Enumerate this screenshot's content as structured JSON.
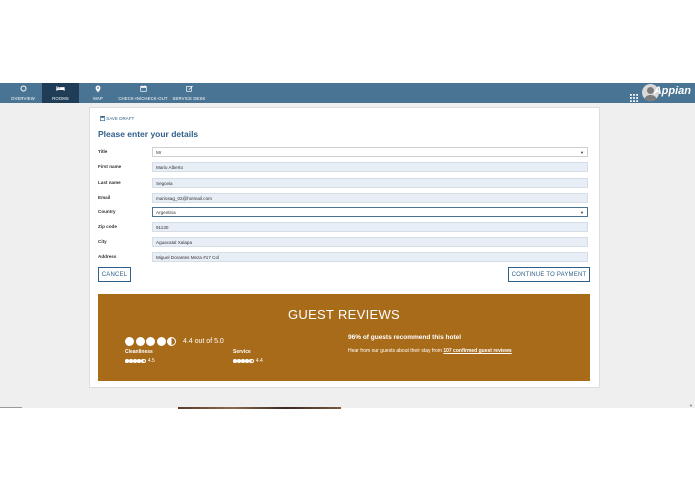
{
  "brand": "Appian",
  "nav": {
    "items": [
      {
        "label": "OVERVIEW",
        "icon": "circle-icon"
      },
      {
        "label": "ROOMS",
        "icon": "bed-icon"
      },
      {
        "label": "MAP",
        "icon": "map-pin-icon"
      },
      {
        "label": "CHECK-IN/CHECK-OUT",
        "icon": "calendar-icon"
      },
      {
        "label": "SERVICE DESK",
        "icon": "edit-icon"
      }
    ],
    "active": "ROOMS"
  },
  "form": {
    "save_draft": "SAVE DRAFT",
    "title": "Please enter your details",
    "fields": [
      {
        "label": "Title",
        "value": "Mr"
      },
      {
        "label": "First name",
        "value": "Mario Alberto"
      },
      {
        "label": "Last name",
        "value": "Segovia"
      },
      {
        "label": "Email",
        "value": "mariosag_02@hotmail.com"
      },
      {
        "label": "Country",
        "value": "Argentina"
      },
      {
        "label": "Zip code",
        "value": "91130"
      },
      {
        "label": "City",
        "value": "Aguacatal Xalapa"
      },
      {
        "label": "Address",
        "value": "Miguel Dorantes Meza #17 Col"
      }
    ],
    "cancel_label": "CANCEL",
    "continue_label": "CONTINUE TO PAYMENT"
  },
  "reviews": {
    "title": "GUEST REVIEWS",
    "rating_text": "4.4 out of 5.0",
    "rating_value": 4.4,
    "categories": [
      {
        "name": "Cleanliness",
        "score": "4.5",
        "value": 4.5
      },
      {
        "name": "Service",
        "score": "4.4",
        "value": 4.4
      }
    ],
    "recommend_text": "96% of guests recommend this hotel",
    "hear_prefix": "Hear from our guests about their stay from",
    "hear_link": "107 confirmed guest reviews",
    "bg_color": "#a86b1a"
  },
  "colors": {
    "topbar": "#4a7494",
    "active_nav": "#1f3d57",
    "accent": "#2f5f8a"
  }
}
